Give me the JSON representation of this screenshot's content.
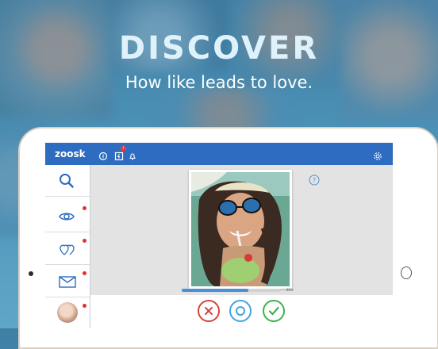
{
  "hero": {
    "title": "DISCOVER",
    "subtitle": "How like leads to love."
  },
  "app": {
    "logo": "zoosk",
    "brand_color": "#2d6cc0",
    "header_icons": [
      "coins-icon",
      "boost-icon",
      "bell-icon",
      "settings-icon"
    ],
    "notification_badge": "!"
  },
  "sidebar": {
    "items": [
      {
        "name": "search",
        "icon": "search-icon",
        "active": true,
        "has_dot": false
      },
      {
        "name": "views",
        "icon": "eye-icon",
        "has_dot": true
      },
      {
        "name": "likes",
        "icon": "hearts-icon",
        "has_dot": true
      },
      {
        "name": "messages",
        "icon": "mail-icon",
        "has_dot": true
      },
      {
        "name": "profile",
        "icon": "avatar",
        "has_dot": true
      }
    ]
  },
  "carousel": {
    "progress_fraction": 0.68,
    "progress_label": "80%"
  },
  "actions": {
    "no_color": "#d9433b",
    "maybe_color": "#44a4dd",
    "yes_color": "#3db34a"
  }
}
